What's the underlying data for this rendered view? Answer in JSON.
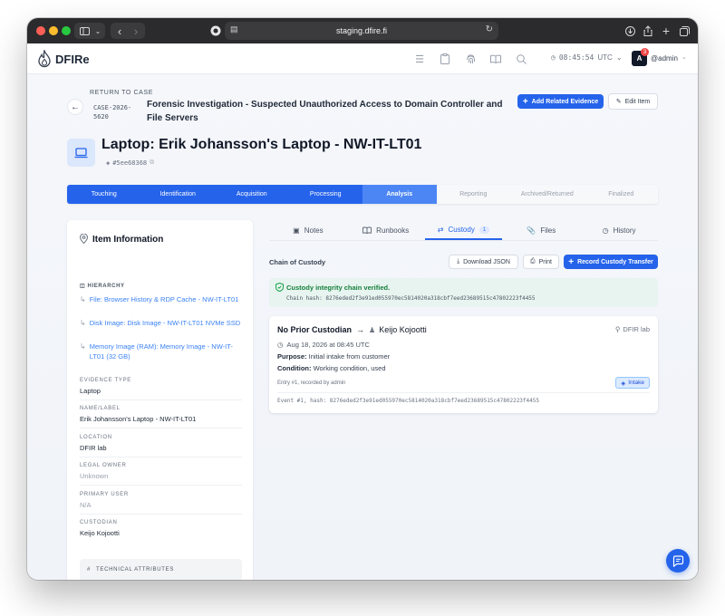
{
  "browser": {
    "url": "staging.dfire.fi"
  },
  "app": {
    "name": "DFIRe",
    "clock": "08:45:54",
    "timezone": "UTC",
    "user": "@admin",
    "user_initial": "A",
    "notification_count": "3"
  },
  "case": {
    "return_label": "RETURN TO CASE",
    "case_id": "CASE-2026-5620",
    "title": "Forensic Investigation - Suspected Unauthorized Access to Domain Controller and File Servers",
    "add_evidence_label": "Add Related Evidence",
    "edit_item_label": "Edit Item"
  },
  "item": {
    "title": "Laptop: Erik Johansson's Laptop - NW-IT-LT01",
    "hash": "#5ee68368"
  },
  "stages": [
    {
      "label": "Touching",
      "state": "done"
    },
    {
      "label": "Identification",
      "state": "done"
    },
    {
      "label": "Acquisition",
      "state": "done"
    },
    {
      "label": "Processing",
      "state": "done"
    },
    {
      "label": "Analysis",
      "state": "active"
    },
    {
      "label": "Reporting",
      "state": "todo"
    },
    {
      "label": "Archived/Returned",
      "state": "todo"
    },
    {
      "label": "Finalized",
      "state": "todo"
    }
  ],
  "info_panel": {
    "title": "Item Information",
    "hierarchy_label": "HIERARCHY",
    "hierarchy": [
      "File: Browser History & RDP Cache - NW-IT-LT01",
      "Disk Image: Disk Image - NW-IT-LT01 NVMe SSD",
      "Memory Image (RAM): Memory Image - NW-IT-LT01 (32 GB)"
    ],
    "fields": [
      {
        "label": "EVIDENCE TYPE",
        "value": "Laptop",
        "muted": false
      },
      {
        "label": "NAME/LABEL",
        "value": "Erik Johansson's Laptop - NW-IT-LT01",
        "muted": false
      },
      {
        "label": "LOCATION",
        "value": "DFIR lab",
        "muted": false
      },
      {
        "label": "LEGAL OWNER",
        "value": "Unknown",
        "muted": true
      },
      {
        "label": "PRIMARY USER",
        "value": "N/A",
        "muted": true
      },
      {
        "label": "CUSTODIAN",
        "value": "Keijo Kojootti",
        "muted": false
      }
    ],
    "technical_label": "TECHNICAL ATTRIBUTES"
  },
  "tabs": {
    "notes": "Notes",
    "runbooks": "Runbooks",
    "custody": "Custody",
    "custody_count": "1",
    "files": "Files",
    "history": "History"
  },
  "custody": {
    "title": "Chain of Custody",
    "download_label": "Download JSON",
    "print_label": "Print",
    "record_label": "Record Custody Transfer",
    "verified_title": "Custody integrity chain verified.",
    "chain_hash": "Chain hash: 8276eded2f3e91ed055970ec5814020a318cbf7eed23689515c47802223f4455",
    "event": {
      "from": "No Prior Custodian",
      "to": "Keijo Kojootti",
      "location": "DFIR lab",
      "date": "Aug 18, 2026 at 08:45 UTC",
      "purpose_label": "Purpose:",
      "purpose": "Initial intake from customer",
      "condition_label": "Condition:",
      "condition": "Working condition, used",
      "entry": "Entry #1, recorded by admin",
      "tag": "Intake",
      "hash": "Event #1, hash: 8276eded2f3e91ed055970ec5814020a318cbf7eed23689515c47802223f4455"
    }
  }
}
